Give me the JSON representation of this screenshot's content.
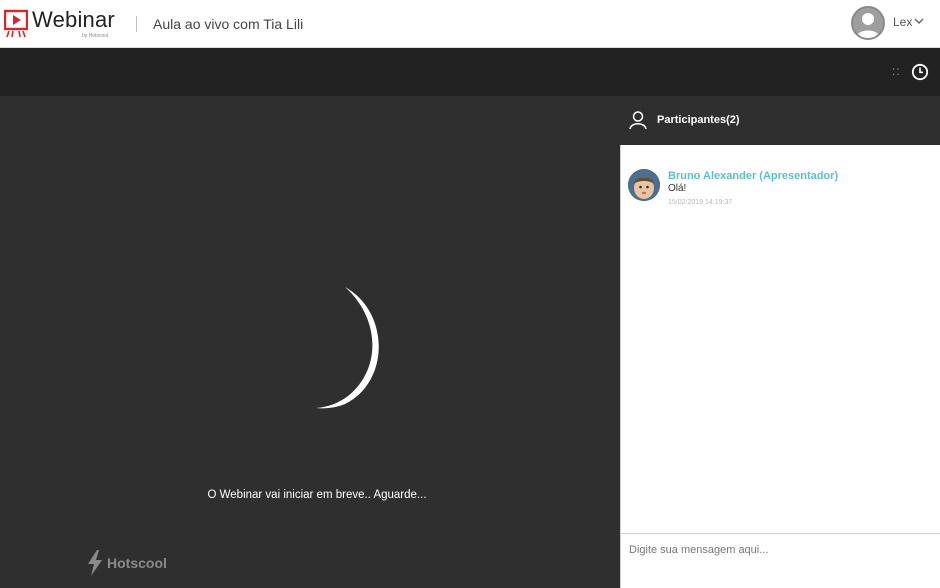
{
  "app": {
    "brand": "Webinar",
    "brand_sub": "by Hotscool",
    "page_title": "Aula ao vivo com Tia Lili"
  },
  "user": {
    "name": "Lex",
    "avatar_icon": "user-avatar-icon",
    "menu_icon": "chevron-down-icon"
  },
  "toolbar": {
    "dots": "::",
    "clock_icon": "clock-icon"
  },
  "stage": {
    "status_text": "O Webinar vai iniciar em breve.. Aguarde...",
    "footer_brand": "Hotscool",
    "spinner_icon": "loading-spinner-icon"
  },
  "sidebar": {
    "participants_label": "Participantes(2)",
    "participants_icon": "person-icon"
  },
  "chat": {
    "messages": [
      {
        "author": "Bruno Alexander (Apresentador)",
        "text": "Olá!",
        "time": "15/02/2019 14:19:37"
      }
    ],
    "input_placeholder": "Digite sua mensagem aqui..."
  },
  "colors": {
    "brand_red": "#d9252b",
    "author_teal": "#58c3c3",
    "stage_bg": "#2f2f2f",
    "toolbar_bg": "#222222"
  }
}
